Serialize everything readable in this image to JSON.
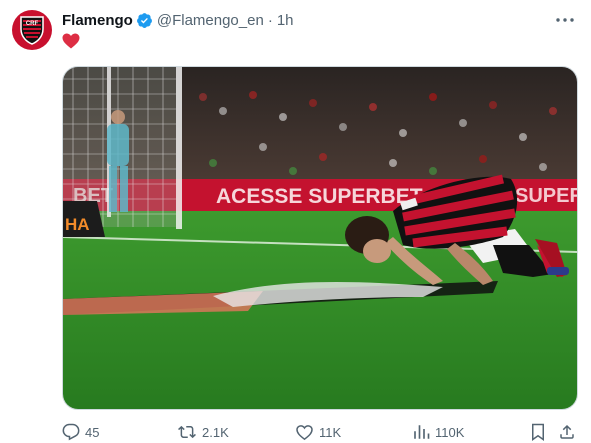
{
  "tweet": {
    "author_name": "Flamengo",
    "handle": "@Flamengo_en",
    "separator": "·",
    "time": "1h",
    "text_emoji": "red-heart-emoji"
  },
  "media": {
    "ad_board_text": "ACESSE SUPERBET",
    "ad_board_left": "BET",
    "ad_board_right": "SUPER",
    "sign_text": "HA",
    "colors": {
      "pitch": "#2f8a27",
      "board": "#c4122f",
      "jersey_red": "#c4122f",
      "jersey_black": "#111111"
    }
  },
  "actions": {
    "replies": "45",
    "reposts": "2.1K",
    "likes": "11K",
    "views": "110K"
  },
  "colors": {
    "verified": "#1d9bf0",
    "muted": "#536471",
    "heart": "#f91880"
  }
}
